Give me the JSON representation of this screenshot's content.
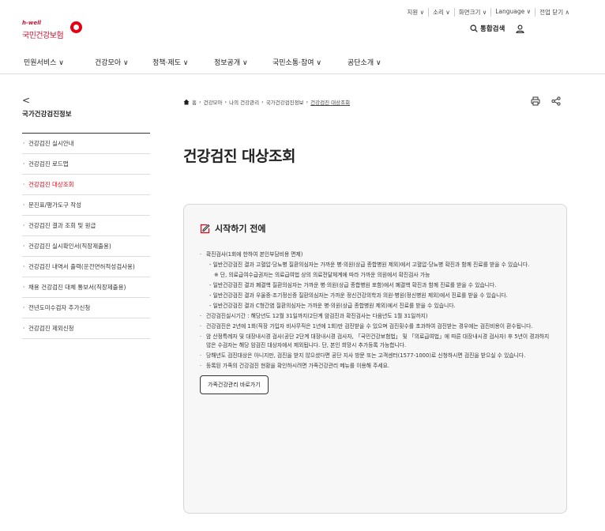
{
  "util": {
    "items": [
      "지원 ∨",
      "소리 ∨",
      "화면크기 ∨",
      "Language ∨",
      "전업 닫기 ∧"
    ]
  },
  "logo": {
    "tag": "h-well",
    "name": "국민건강보험"
  },
  "search": {
    "label": "통합검색"
  },
  "gnb": {
    "items": [
      "민원서비스 ∨",
      "건강모아 ∨",
      "정책·제도 ∨",
      "정보공개 ∨",
      "국민소통·참여 ∨",
      "공단소개 ∨"
    ]
  },
  "sidebar": {
    "back": "<",
    "title": "국가건강검진정보",
    "items": [
      "건강검진 실시안내",
      "건강검진 로드맵",
      "건강검진 대상조회",
      "문진표/평가도구 작성",
      "건강검진 결과 조회 및 원급",
      "건강검진 실시확인서(직장제출용)",
      "건강검진 내역서 출력(운전면허적성검사용)",
      "채용 건강검진 대체 통보서(직장제출용)",
      "전년도미수검자 추가신청",
      "건강검진 제외신청"
    ]
  },
  "breadcrumb": {
    "items": [
      "홈",
      "건강모아",
      "나의 건강관리",
      "국가건강검진정보",
      "건강검진 대상조회"
    ]
  },
  "page": {
    "title": "건강검진 대상조회"
  },
  "box": {
    "heading": "시작하기 전에",
    "lines": [
      "확진검사(1회에 한하여 본인부담비용 면제)",
      "- 일반건강검진 결과 고혈압·당뇨병 질환의심자는 가까운 병·의원(상급 종합병원 제외)에서 고혈압·당뇨병 확진과 함께 진료를 받을 수 있습니다.",
      "※ 단, 의료급여수급권자는 의료급여법 상의 의료전달체계에 따라 가까운 의원에서 확진검사 가능",
      "- 일반건강검진 결과 폐결핵 질환의심자는 가까운 병·의원(상급 종합병원 포함)에서 폐결핵 확진과 함께 진료를 받을 수 있습니다.",
      "- 일반건강검진 결과 우울증·조기정신증 질환의심자는 가까운 정신건강의학과 의원·병원(정신병원 제외)에서 진료를 받을 수 있습니다.",
      "- 일반건강검진 결과 C형간염 질환의심자는 가까운 병·의원(상급 종합병원 제외)에서 진료를 받을 수 있습니다.",
      "건강검진실시기간 : 해당년도 12월 31일까지(2단계 암검진과 확진검사는 다음년도 1월 31일까지)",
      "건강검진은 2년에 1회(직장 가입자 비사무직은 1년에 1회)만 검진받을 수 있으며 검진횟수를 초과하여 검진받는 경우에는 검진비용이 환수됩니다.",
      "암 산정특례자 및 대장내시경 검사(공단 2단계 대장내시경 검사자, 「국민건강보험법」 및 「의료급여법」에 따른 대장내시경 검사자) 후 5년이 경과하지 않은 수검자는 해당 암검진 대상자에서 제외됩니다. 단, 본인 희망시 추가등록 가능합니다.",
      "당해년도 검진대상은 아니지만, 검진을 받지 않으셨다면 공단 지사 방문 또는 고객센터(1577-1000)로 신청하시면 검진을 받으실 수 있습니다.",
      "등록된 가족의 건강검진 현황을 확인하시려면 가족건강관리 메뉴를 이용해 주세요."
    ],
    "button": "가족건강관리 바로가기"
  }
}
